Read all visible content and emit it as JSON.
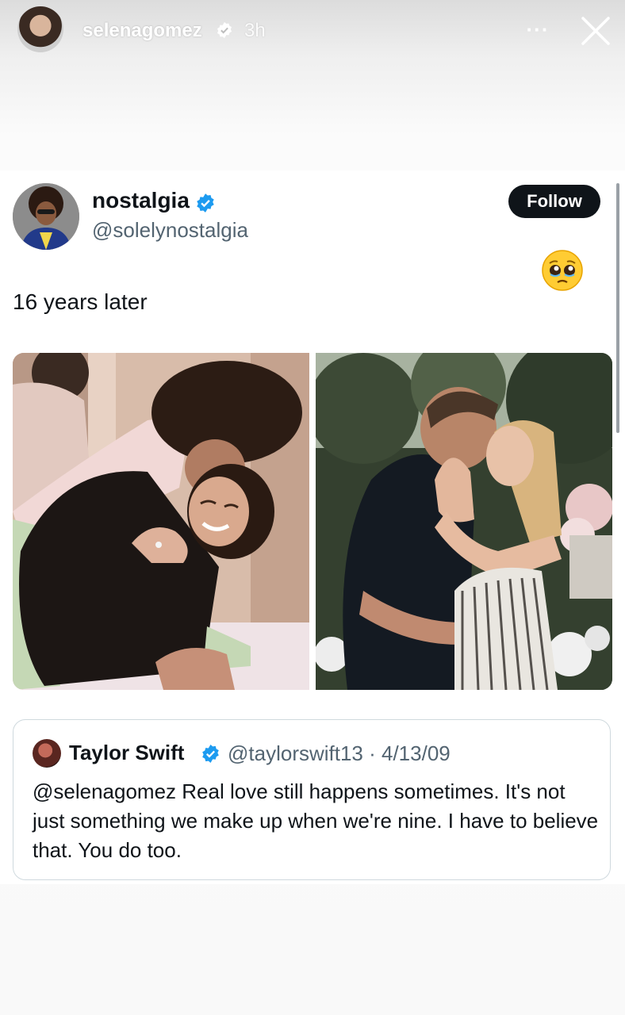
{
  "story": {
    "username": "selenagomez",
    "time": "3h",
    "more_label": "···"
  },
  "tweet": {
    "display_name": "nostalgia",
    "handle": "@solelynostalgia",
    "follow_label": "Follow",
    "text": "16 years later",
    "emoji": "🥹",
    "photos": [
      "couple-hug-ring-photo",
      "couple-embrace-garden-photo"
    ]
  },
  "quoted": {
    "display_name": "Taylor Swift",
    "handle_date": "@taylorswift13 · 4/13/09",
    "body": "@selenagomez Real love still happens sometimes. It's not just something we make up when we're nine. I have to believe that. You do too."
  },
  "colors": {
    "verified": "#1d9bf0",
    "follow_bg": "#0f1419",
    "secondary_text": "#536471"
  }
}
